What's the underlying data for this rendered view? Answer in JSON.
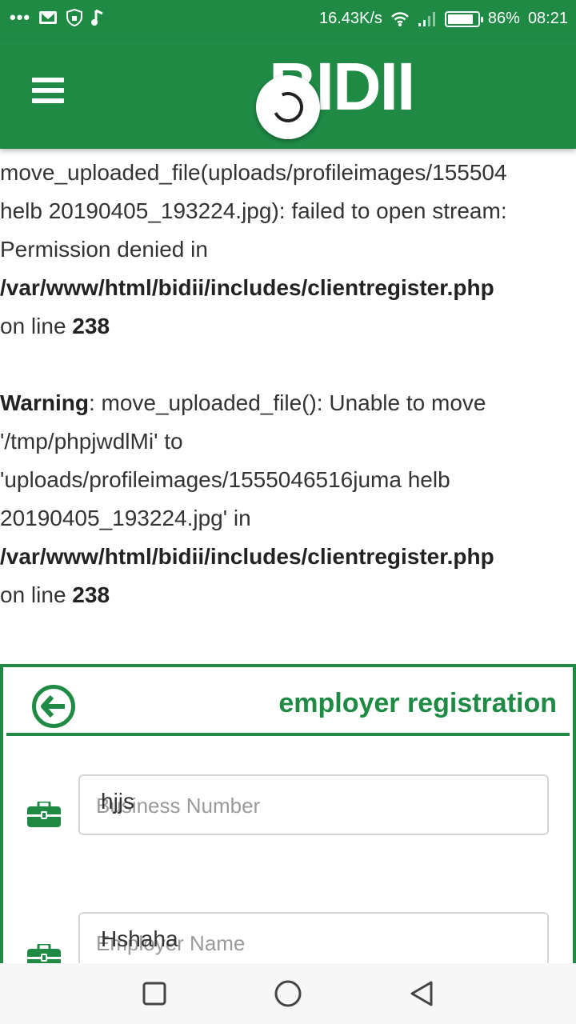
{
  "status_bar": {
    "dots": "•••",
    "speed": "16.43K/s",
    "battery_pct": "86%",
    "battery_level": 0.86,
    "time": "08:21",
    "icons": [
      "mail-icon",
      "shield-icon",
      "music-note-icon",
      "wifi-icon",
      "signal-icon",
      "battery-icon"
    ]
  },
  "header": {
    "logo": "BIDII",
    "menu_icon": "hamburger-menu-icon",
    "loading_icon": "loading-spinner-icon"
  },
  "error_output": {
    "line1": "move_uploaded_file(uploads/profileimages/155504",
    "line2": "helb 20190405_193224.jpg): failed to open stream:",
    "line3": "Permission denied in",
    "path1": "/var/www/html/bidii/includes/clientregister.php",
    "on_line_prefix1": "on line ",
    "line_number1": "238",
    "warning_label": "Warning",
    "warning_rest": ": move_uploaded_file(): Unable to move",
    "warning_line2": "'/tmp/phpjwdlMi' to",
    "warning_line3": "'uploads/profileimages/1555046516juma helb",
    "warning_line4": "20190405_193224.jpg' in",
    "path2": "/var/www/html/bidii/includes/clientregister.php",
    "on_line_prefix2": "on line ",
    "line_number2": "238"
  },
  "registration": {
    "title": "employer registration",
    "back_icon": "back-arrow-circle-icon",
    "fields": [
      {
        "placeholder": "Business Number",
        "value": "hjjs",
        "icon": "briefcase-icon"
      },
      {
        "placeholder": "Employer Name",
        "value": "Hshaha",
        "icon": "briefcase-icon"
      }
    ]
  },
  "nav_bar": {
    "icons": [
      "recents-square-icon",
      "home-circle-icon",
      "back-triangle-icon"
    ]
  },
  "colors": {
    "brand_green": "#1e8a44",
    "text": "#333333",
    "placeholder": "#9a9a9a"
  }
}
